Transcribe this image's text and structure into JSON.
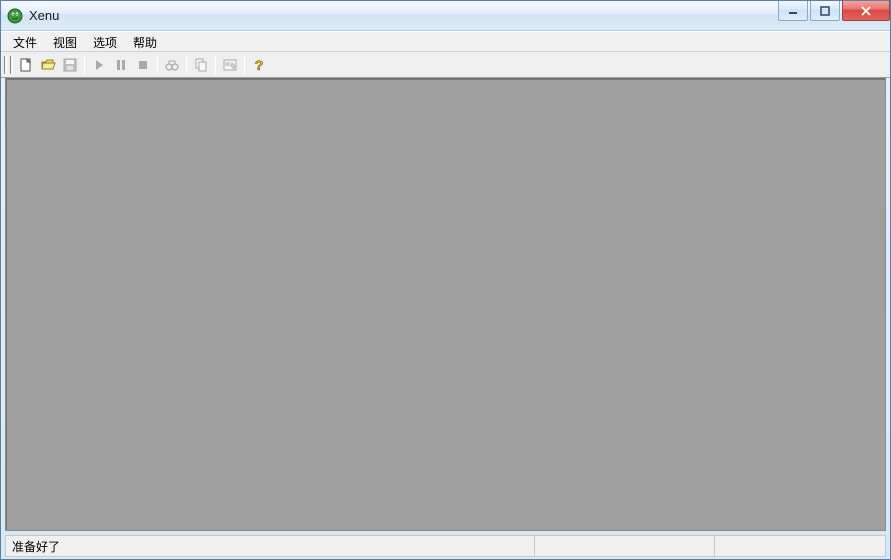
{
  "window": {
    "title": "Xenu"
  },
  "menu": {
    "file": "文件",
    "view": "视图",
    "options": "选项",
    "help": "帮助"
  },
  "toolbar": {
    "new": "new",
    "open": "open",
    "save": "save",
    "play": "play",
    "pause": "pause",
    "stop": "stop",
    "find": "find",
    "copy": "copy",
    "properties": "properties",
    "about": "about"
  },
  "status": {
    "ready": "准备好了",
    "mid": "",
    "right": ""
  }
}
